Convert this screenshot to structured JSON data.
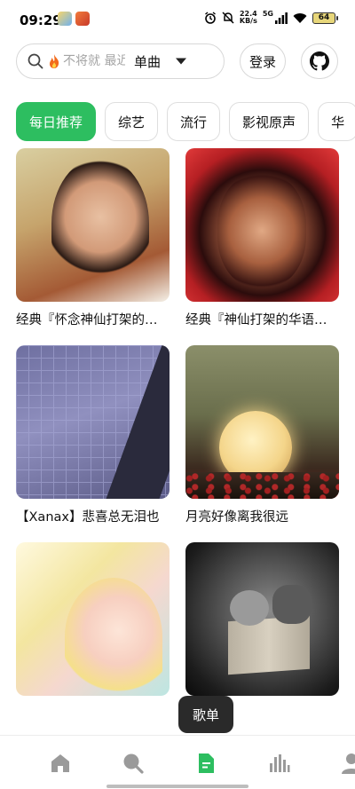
{
  "status_bar": {
    "time": "09:29",
    "net_speed_value": "22.4",
    "net_speed_unit": "KB/s",
    "signal_label": "5G",
    "battery": "64"
  },
  "header": {
    "search_placeholder": "不将就 最近",
    "search_type": "单曲",
    "login_label": "登录"
  },
  "tabs": [
    {
      "label": "每日推荐",
      "active": true
    },
    {
      "label": "综艺",
      "active": false
    },
    {
      "label": "流行",
      "active": false
    },
    {
      "label": "影视原声",
      "active": false
    },
    {
      "label": "华",
      "active": false
    }
  ],
  "playlists": [
    {
      "title": "经典『怀念神仙打架的华语乐坛』"
    },
    {
      "title": "经典『神仙打架的华语乐坛』"
    },
    {
      "title": "【Xanax】悲喜总无泪也"
    },
    {
      "title": "月亮好像离我很远"
    },
    {
      "title": ""
    },
    {
      "title": ""
    }
  ],
  "tooltip": "歌单",
  "bottom_nav": [
    {
      "icon": "home-icon"
    },
    {
      "icon": "search-icon"
    },
    {
      "icon": "playlist-icon",
      "active": true
    },
    {
      "icon": "chart-icon"
    },
    {
      "icon": "user-icon"
    }
  ],
  "colors": {
    "accent": "#2dbe60",
    "tooltip_bg": "#2a2a2a"
  }
}
